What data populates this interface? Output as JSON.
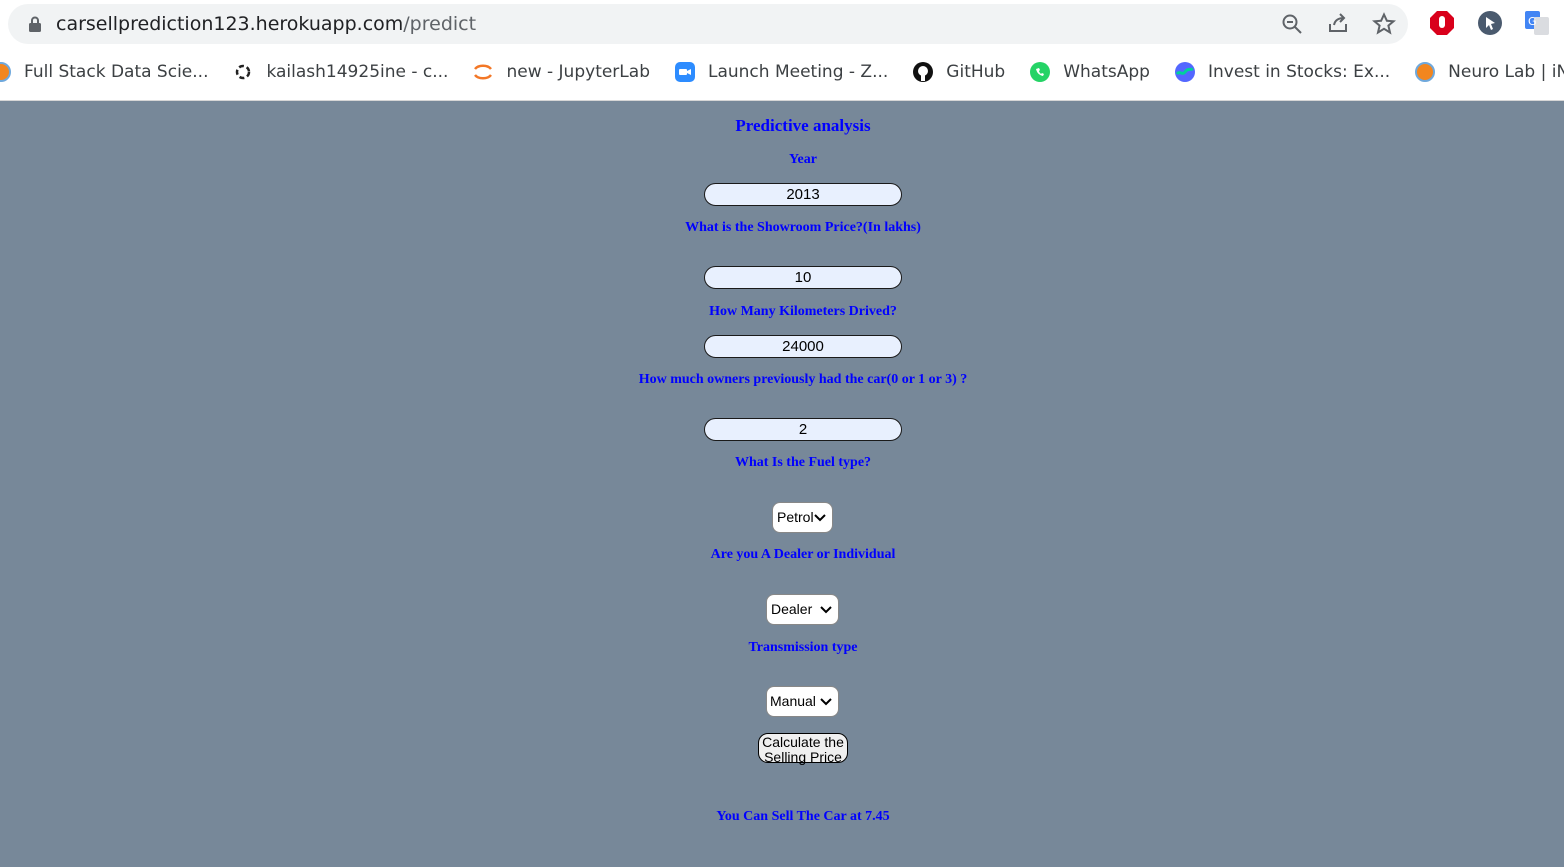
{
  "browser": {
    "url_host": "carsellprediction123.herokuapp.com",
    "url_path": "/predict",
    "bookmarks": [
      {
        "label": "Full Stack Data Scie...",
        "icon": "orange-circle-icon"
      },
      {
        "label": "kailash14925ine - c...",
        "icon": "spinner-icon"
      },
      {
        "label": "new - JupyterLab",
        "icon": "jupyter-icon"
      },
      {
        "label": "Launch Meeting - Z...",
        "icon": "zoom-icon"
      },
      {
        "label": "GitHub",
        "icon": "github-icon"
      },
      {
        "label": "WhatsApp",
        "icon": "whatsapp-icon"
      },
      {
        "label": "Invest in Stocks: Ex...",
        "icon": "stocks-icon"
      },
      {
        "label": "Neuro Lab | iNeuro...",
        "icon": "orange-circle-icon"
      }
    ]
  },
  "form": {
    "title": "Predictive analysis",
    "year_label": "Year",
    "year_value": "2013",
    "price_label": "What is the Showroom Price?(In lakhs)",
    "price_value": "10",
    "km_label": "How Many Kilometers Drived?",
    "km_value": "24000",
    "owners_label": "How much owners previously had the car(0 or 1 or 3) ?",
    "owners_value": "2",
    "fuel_label": "What Is the Fuel type?",
    "fuel_value": "Petrol",
    "seller_label": "Are you A Dealer or Individual",
    "seller_value": "Dealer",
    "transmission_label": "Transmission type",
    "transmission_value": "Manual",
    "submit_label": "Calculate the Selling Price",
    "result": "You Can Sell The Car at 7.45"
  },
  "colors": {
    "page_bg": "#778899",
    "label": "#0000ff",
    "input_bg": "#e8f0fe"
  }
}
